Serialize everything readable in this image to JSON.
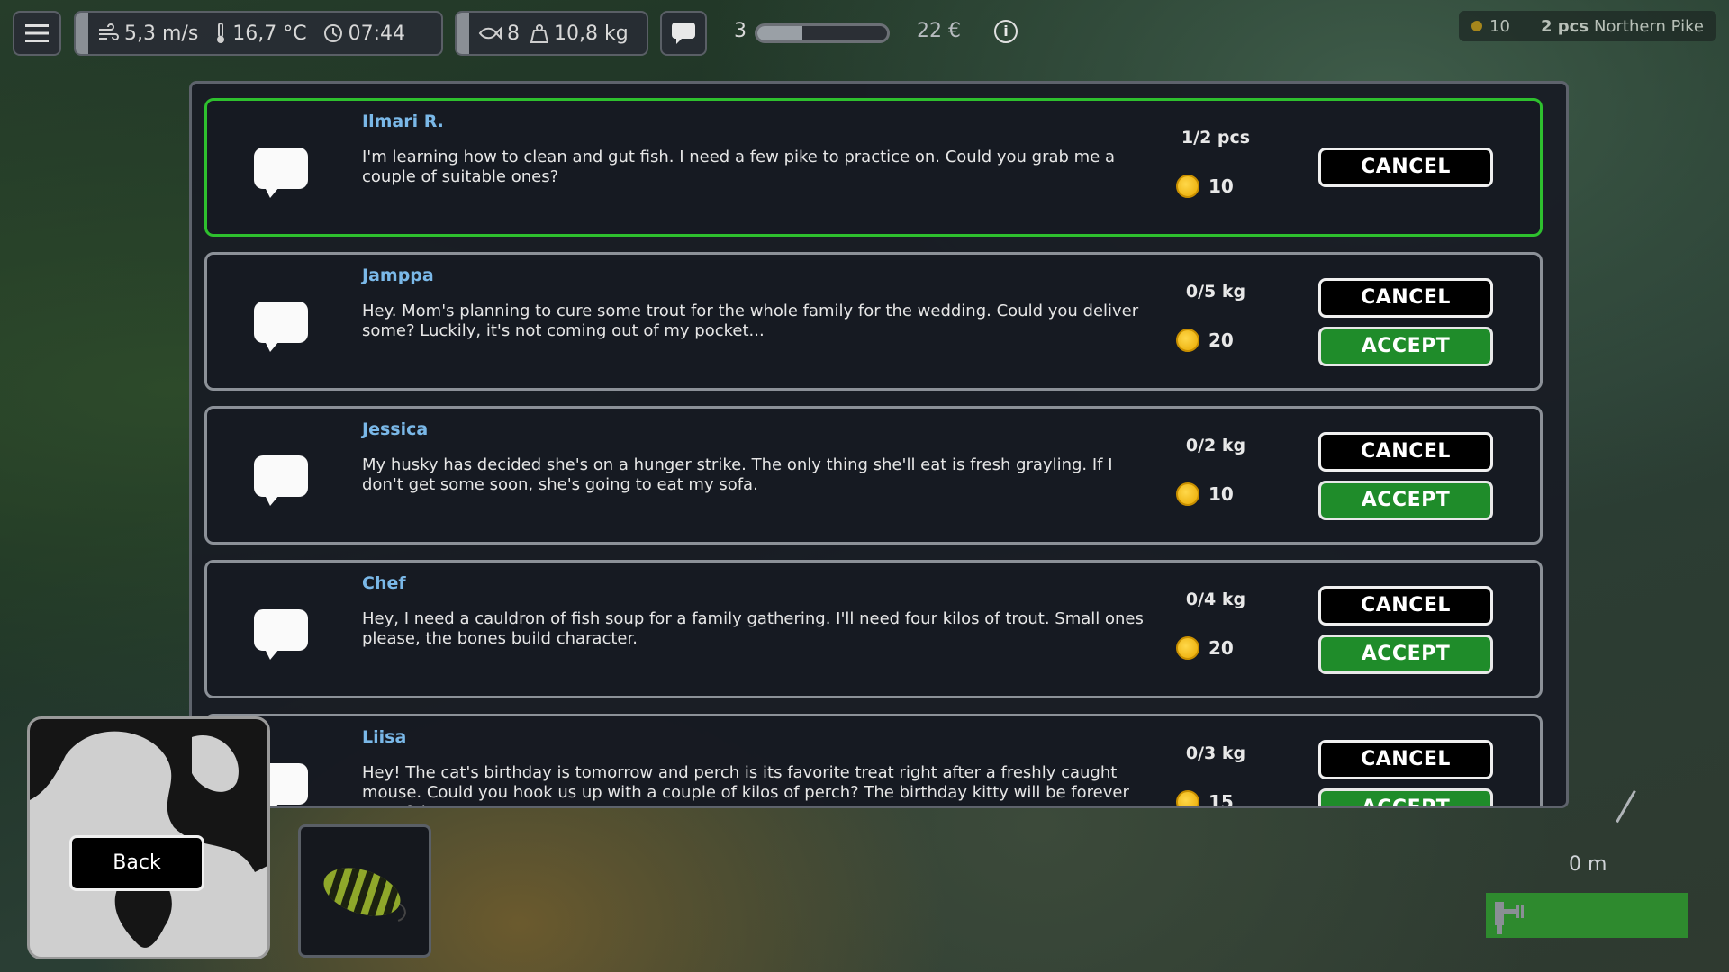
{
  "hud": {
    "wind": "5,3 m/s",
    "temperature": "16,7 °C",
    "time": "07:44",
    "fish_count": "8",
    "weight": "10,8 kg",
    "level": "3",
    "xp_progress": 0.35,
    "money": "22 €"
  },
  "quest_tracker": {
    "reward": "10",
    "amount": "2 pcs",
    "fish": "Northern Pike"
  },
  "quests": [
    {
      "name": "Ilmari R.",
      "message": "I'm learning how to clean and gut fish. I need a few pike to practice on. Could you grab me a couple of suitable ones?",
      "progress": "1/2 pcs",
      "reward": "10",
      "cancel_label": "CANCEL",
      "accept_label": ""
    },
    {
      "name": "Jamppa",
      "message": "Hey. Mom's planning to cure some trout for the whole family for the wedding. Could you deliver some? Luckily, it's not coming out of my pocket...",
      "progress": "0/5 kg",
      "reward": "20",
      "cancel_label": "CANCEL",
      "accept_label": "ACCEPT"
    },
    {
      "name": "Jessica",
      "message": "My husky has decided she's on a hunger strike. The only thing she'll eat is fresh grayling. If I don't get some soon, she's going to eat my sofa.",
      "progress": "0/2 kg",
      "reward": "10",
      "cancel_label": "CANCEL",
      "accept_label": "ACCEPT"
    },
    {
      "name": "Chef",
      "message": "Hey, I need a cauldron of fish soup for a family gathering. I'll need four kilos of trout. Small ones please, the bones build character.",
      "progress": "0/4 kg",
      "reward": "20",
      "cancel_label": "CANCEL",
      "accept_label": "ACCEPT"
    },
    {
      "name": "Liisa",
      "message": "Hey! The cat's birthday is tomorrow and perch is its favorite treat right after a freshly caught mouse. Could you hook us up with a couple of kilos of perch? The birthday kitty will be forever grateful!",
      "progress": "0/3 kg",
      "reward": "15",
      "cancel_label": "CANCEL",
      "accept_label": "ACCEPT"
    }
  ],
  "bottom": {
    "back_label": "Back",
    "distance": "0 m"
  }
}
